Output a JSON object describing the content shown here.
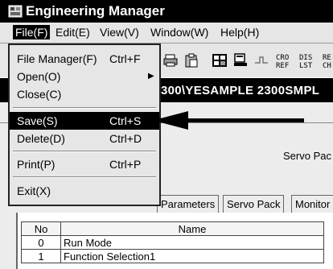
{
  "window": {
    "title": "Engineering Manager",
    "icon": "app-icon"
  },
  "menubar": {
    "items": [
      {
        "label": "File(F)",
        "active": true
      },
      {
        "label": "Edit(E)"
      },
      {
        "label": "View(V)"
      },
      {
        "label": "Window(W)"
      },
      {
        "label": "Help(H)"
      }
    ]
  },
  "file_menu": {
    "items": [
      {
        "label": "File Manager(F)",
        "shortcut": "Ctrl+F"
      },
      {
        "label": "Open(O)",
        "shortcut": "",
        "submenu": "▶"
      },
      {
        "label": "Close(C)",
        "shortcut": ""
      },
      {
        "label": "Save(S)",
        "shortcut": "Ctrl+S",
        "selected": true
      },
      {
        "label": "Delete(D)",
        "shortcut": "Ctrl+D"
      },
      {
        "label": "Print(P)",
        "shortcut": "Ctrl+P"
      },
      {
        "label": "Exit(X)",
        "shortcut": ""
      }
    ]
  },
  "toolbar": {
    "labels": [
      {
        "top": "CRO",
        "bottom": "REF"
      },
      {
        "top": "DIS",
        "bottom": "LST"
      },
      {
        "top": "RE",
        "bottom": "CH"
      }
    ]
  },
  "pathbar": {
    "text": "300\\YESAMPLE  2300SMPL"
  },
  "content": {
    "servo_label": "Servo Pac",
    "tabs": [
      "Parameters",
      "Servo Pack",
      "Monitor"
    ]
  },
  "table": {
    "columns": [
      "No",
      "Name"
    ],
    "rows": [
      {
        "no": "0",
        "name": "Run Mode"
      },
      {
        "no": "1",
        "name": "Function Selection1"
      }
    ]
  },
  "colors": {
    "titlebar": "#000000",
    "menubar": "#e6e6e6",
    "highlight": "#000000"
  }
}
